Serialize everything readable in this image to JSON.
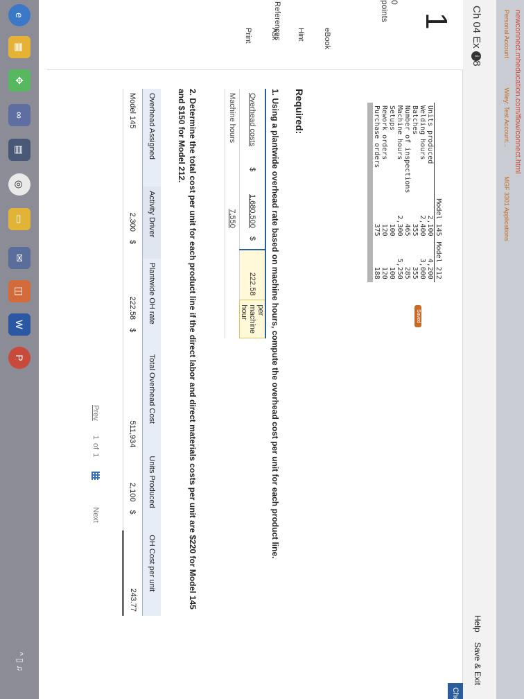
{
  "browser": {
    "url": "newconnect.mheducation.com/flow/connect.html",
    "bookmarks": [
      "Personal Account",
      "Wiley: Test Account...",
      "MGF 3301 Applications"
    ]
  },
  "header": {
    "title": "Ch 04 Ex 4-8",
    "info": "i",
    "saved": "Saved",
    "help": "Help",
    "save_exit": "Save & Exit",
    "check": "Check my"
  },
  "rail": {
    "question_number": "1",
    "points": "0\npoints",
    "links": [
      "eBook",
      "Hint",
      "Ask",
      "Print"
    ],
    "references": "References"
  },
  "data_table": {
    "headers": [
      "",
      "Model 145",
      "Model 212"
    ],
    "rows": [
      [
        "Units produced",
        "2,100",
        "4,200"
      ],
      [
        "Welding hours",
        "2,400",
        "3,000"
      ],
      [
        "Batches",
        "355",
        "355"
      ],
      [
        "Number of inspections",
        "465",
        "285"
      ],
      [
        "Machine hours",
        "2,300",
        "5,250"
      ],
      [
        "Setups",
        "100",
        "100"
      ],
      [
        "Rework orders",
        "120",
        "120"
      ],
      [
        "Purchase orders",
        "375",
        "188"
      ]
    ]
  },
  "required": "Required:",
  "q1": {
    "text": "1. Using a plantwide overhead rate based on machine hours, compute the overhead cost per unit for each product line.",
    "row1_label": "Overhead costs",
    "row1_cur": "$",
    "row1_val": "1,680,500",
    "row1_cur2": "$",
    "row1_result": "222.58",
    "row1_unit": "per machine hour",
    "row2_label": "Machine hours",
    "row2_val": "7,550"
  },
  "q2": {
    "text": "2. Determine the total cost per unit for each product line if the direct labor and direct materials costs per unit are $220 for Model 145 and $150 for Model 212."
  },
  "assign": {
    "headers": [
      "Overhead Assigned",
      "Activity Driver",
      "Plantwide OH rate",
      "Total Overhead Cost",
      "Units Produced",
      "OH Cost per unit"
    ],
    "row": {
      "label": "Model 145",
      "driver": "2,300",
      "cur1": "$",
      "rate": "222.58",
      "cur2": "$",
      "total": "511,934",
      "units": "2,100",
      "cur3": "$",
      "per_unit": "243.77"
    }
  },
  "pager": {
    "prev": "Prev",
    "page": "1",
    "of": "of",
    "total": "1",
    "next": "Next"
  }
}
